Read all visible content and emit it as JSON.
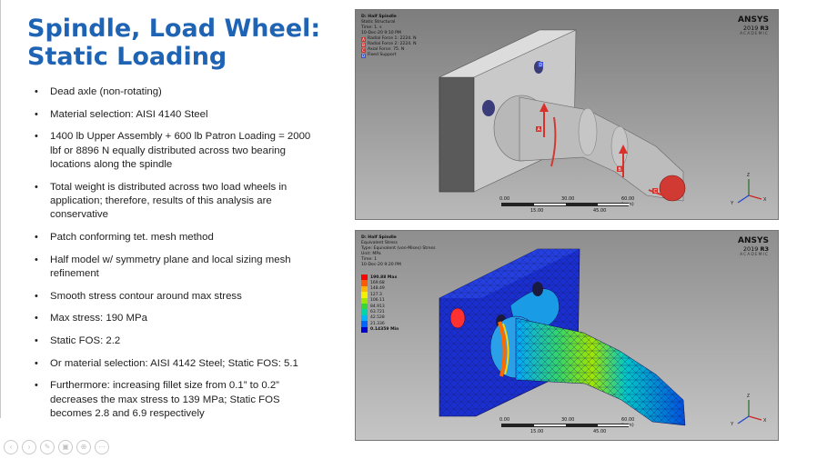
{
  "slide": {
    "title_line1": "Spindle, Load Wheel:",
    "title_line2": "Static Loading",
    "bullets": [
      "Dead axle (non-rotating)",
      "Material selection: AISI 4140 Steel",
      "1400 lb Upper Assembly + 600 lb Patron Loading = 2000 lbf or 8896 N equally distributed across two bearing locations along the spindle",
      "Total weight is distributed across two load wheels in application; therefore, results of this analysis are conservative",
      "Patch conforming tet. mesh method",
      "Half model w/ symmetry plane and local sizing mesh refinement",
      "Smooth stress contour around max stress",
      "Max stress: 190 MPa",
      "Static FOS: 2.2",
      "Or material selection: AISI 4142 Steel; Static FOS: 5.1",
      "Furthermore: increasing fillet size from 0.1” to 0.2” decreases the max stress to 139 MPa; Static FOS becomes 2.8 and 6.9 respectively"
    ]
  },
  "panel_static": {
    "heading": "D: Half Spindle",
    "line1": "Static Structural",
    "line2": "Time: 1. s",
    "line3": "10-Dec-20 9:10 PM",
    "loads": [
      {
        "tag": "A",
        "label": "Radial Force 1: 2224. N",
        "color": "#d9302b"
      },
      {
        "tag": "B",
        "label": "Radial Force 2: 2224. N",
        "color": "#d9302b"
      },
      {
        "tag": "C",
        "label": "Axial Force: 75. N",
        "color": "#d9302b"
      },
      {
        "tag": "D",
        "label": "Fixed Support",
        "color": "#3a4fd6"
      }
    ],
    "brand": "ANSYS",
    "version_prefix": "2019",
    "version_suffix": "R3",
    "edition": "ACADEMIC",
    "scale_top": [
      "0.00",
      "30.00",
      "60.00 (mm)"
    ],
    "scale_bottom": [
      "15.00",
      "45.00"
    ]
  },
  "panel_stress": {
    "heading": "D: Half Spindle",
    "line1": "Equivalent Stress",
    "line2": "Type: Equivalent (von-Mises) Stress",
    "line3": "Unit: MPa",
    "line4": "Time: 1",
    "line5": "10-Dec-20 9:20 PM",
    "brand": "ANSYS",
    "version_prefix": "2019",
    "version_suffix": "R3",
    "edition": "ACADEMIC",
    "contour_levels": [
      {
        "label": "190.88 Max",
        "color": "#ff0000"
      },
      {
        "label": "169.68",
        "color": "#ff5a00"
      },
      {
        "label": "148.49",
        "color": "#ffb400"
      },
      {
        "label": "127.3",
        "color": "#f2f200"
      },
      {
        "label": "106.11",
        "color": "#9ee600"
      },
      {
        "label": "84.913",
        "color": "#36d636"
      },
      {
        "label": "63.721",
        "color": "#00d6a8"
      },
      {
        "label": "42.528",
        "color": "#00b4ff"
      },
      {
        "label": "21.336",
        "color": "#0064ff"
      },
      {
        "label": "0.14359 Min",
        "color": "#0000d0"
      }
    ],
    "scale_top": [
      "0.00",
      "30.00",
      "60.00 (mm)"
    ],
    "scale_bottom": [
      "15.00",
      "45.00"
    ]
  },
  "nav_icons": [
    "back-icon",
    "forward-icon",
    "pen-icon",
    "slides-icon",
    "zoom-icon",
    "more-icon"
  ]
}
